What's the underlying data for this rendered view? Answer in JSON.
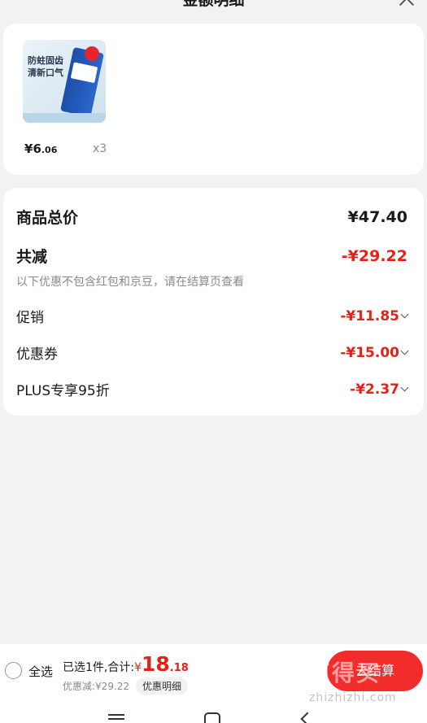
{
  "header": {
    "title": "金额明细"
  },
  "product": {
    "image_text": "防蛀固齿\n清新口气",
    "price_symbol": "¥",
    "price_int": "6",
    "price_dec": ".06",
    "quantity": "x3"
  },
  "breakdown": {
    "total_label": "商品总价",
    "total_value": "¥47.40",
    "reduce_label": "共减",
    "reduce_value": "-¥29.22",
    "note": "以下优惠不包含红包和京豆，请在结算页查看",
    "items": [
      {
        "label": "促销",
        "value": "-¥11.85"
      },
      {
        "label": "优惠券",
        "value": "-¥15.00"
      },
      {
        "label": "PLUS专享95折",
        "value": "-¥2.37"
      }
    ]
  },
  "bottom": {
    "select_all": "全选",
    "selected_text": "已选1件,合计:",
    "total_symbol": "¥",
    "total_int": "18",
    "total_dec": ".18",
    "discount_text": "优惠减:¥29.22",
    "detail_label": "优惠明细",
    "checkout_label": "去结算",
    "watermark": "值得买",
    "watermark_url": "zhizhizhi.com"
  },
  "colors": {
    "accent": "#e2231a",
    "button": "#f22b2b",
    "background": "#f2f2f2"
  }
}
